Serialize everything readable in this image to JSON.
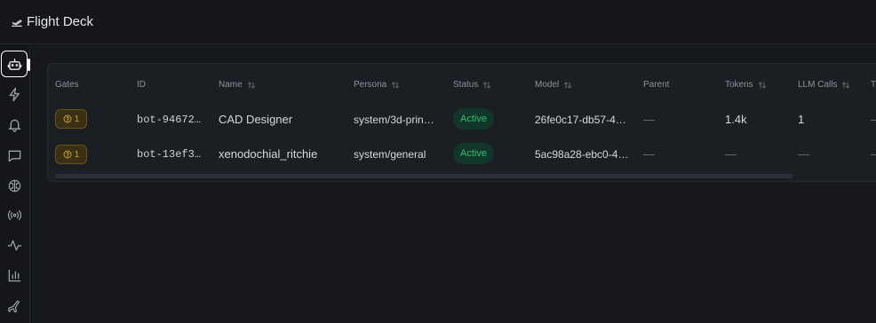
{
  "app": {
    "title": "Flight Deck",
    "logo_icon": "plane-takeoff-icon"
  },
  "sidebar": {
    "items": [
      {
        "name": "bots",
        "icon": "robot-icon",
        "active": true
      },
      {
        "name": "triggers",
        "icon": "lightning-icon",
        "active": false
      },
      {
        "name": "notifications",
        "icon": "bell-icon",
        "active": false
      },
      {
        "name": "messages",
        "icon": "message-square-icon",
        "active": false
      },
      {
        "name": "brain",
        "icon": "brain-icon",
        "active": false
      },
      {
        "name": "broadcast",
        "icon": "radio-icon",
        "active": false
      },
      {
        "name": "activity",
        "icon": "activity-icon",
        "active": false
      },
      {
        "name": "analytics",
        "icon": "bar-chart-icon",
        "active": false
      },
      {
        "name": "flights",
        "icon": "plane-icon",
        "active": false
      }
    ]
  },
  "table": {
    "columns": [
      {
        "key": "gates",
        "label": "Gates",
        "sortable": false
      },
      {
        "key": "id",
        "label": "ID",
        "sortable": false
      },
      {
        "key": "name",
        "label": "Name",
        "sortable": true
      },
      {
        "key": "persona",
        "label": "Persona",
        "sortable": true
      },
      {
        "key": "status",
        "label": "Status",
        "sortable": true
      },
      {
        "key": "model",
        "label": "Model",
        "sortable": true
      },
      {
        "key": "parent",
        "label": "Parent",
        "sortable": false
      },
      {
        "key": "tokens",
        "label": "Tokens",
        "sortable": true
      },
      {
        "key": "llm_calls",
        "label": "LLM Calls",
        "sortable": true
      },
      {
        "key": "more",
        "label": "T",
        "sortable": false
      }
    ],
    "rows": [
      {
        "gates": "1",
        "id": "bot-94672…",
        "name": "CAD Designer",
        "persona": "system/3d-prin…",
        "status": "Active",
        "model": "26fe0c17-db57-4…",
        "parent": "—",
        "tokens": "1.4k",
        "llm_calls": "1",
        "more": "—"
      },
      {
        "gates": "1",
        "id": "bot-13ef3…",
        "name": "xenodochial_ritchie",
        "persona": "system/general",
        "status": "Active",
        "model": "5ac98a28-ebc0-4…",
        "parent": "—",
        "tokens": "—",
        "llm_calls": "—",
        "more": "—"
      }
    ]
  },
  "colors": {
    "background": "#141619",
    "card": "#1b1e22",
    "gate_badge_bg": "#3b2f14",
    "gate_badge_text": "#c99a3c",
    "status_active_bg": "#12372a",
    "status_active_text": "#2fbf71"
  }
}
